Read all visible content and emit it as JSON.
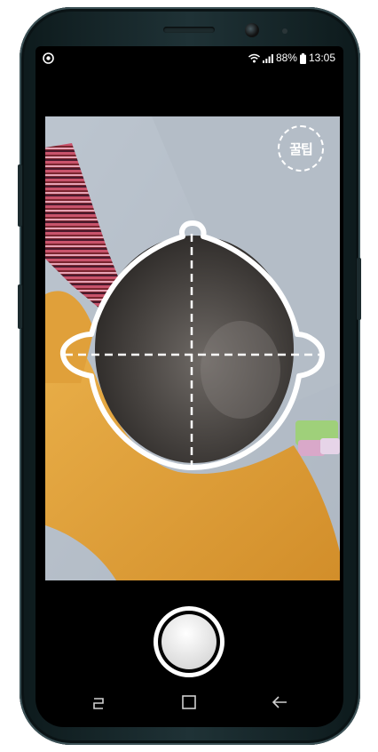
{
  "status_bar": {
    "battery_percent": "88%",
    "time": "13:05",
    "app_icon": "notification-app-icon",
    "wifi_icon": "wifi-icon",
    "signal_icon": "signal-icon",
    "battery_icon": "battery-icon"
  },
  "camera": {
    "tip_badge_label": "꿀팁",
    "guide_overlay": "head-outline-guide",
    "shutter_icon": "shutter-button"
  },
  "nav_bar": {
    "recent_icon": "recent-apps-icon",
    "home_icon": "home-icon",
    "back_icon": "back-arrow-icon"
  },
  "colors": {
    "screen_bg": "#000000",
    "overlay_white": "#ffffff",
    "shirt_yellow": "#e7a43a"
  }
}
